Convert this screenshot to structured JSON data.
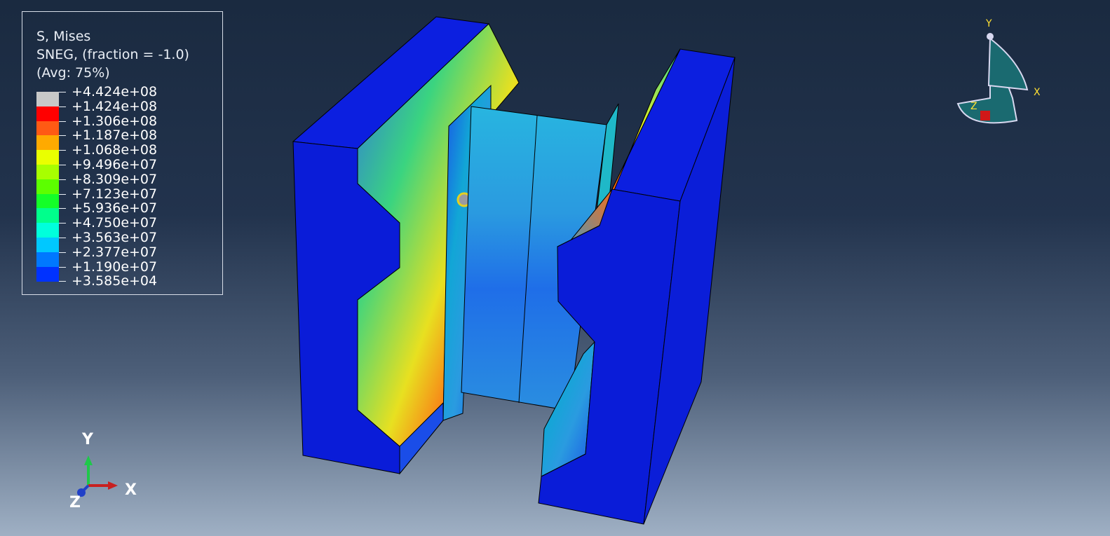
{
  "legend": {
    "line1": "S, Mises",
    "line2": "SNEG, (fraction = -1.0)",
    "line3": "(Avg: 75%)",
    "levels": [
      {
        "label": "+4.424e+08",
        "color": "#c8c8c8"
      },
      {
        "label": "+1.424e+08",
        "color": "#ff0000"
      },
      {
        "label": "+1.306e+08",
        "color": "#ff5a14"
      },
      {
        "label": "+1.187e+08",
        "color": "#ffaa00"
      },
      {
        "label": "+1.068e+08",
        "color": "#eaff00"
      },
      {
        "label": "+9.496e+07",
        "color": "#a8ff00"
      },
      {
        "label": "+8.309e+07",
        "color": "#5cff00"
      },
      {
        "label": "+7.123e+07",
        "color": "#14ff28"
      },
      {
        "label": "+5.936e+07",
        "color": "#00ff8c"
      },
      {
        "label": "+4.750e+07",
        "color": "#00ffdc"
      },
      {
        "label": "+3.563e+07",
        "color": "#00c8ff"
      },
      {
        "label": "+2.377e+07",
        "color": "#0078ff"
      },
      {
        "label": "+1.190e+07",
        "color": "#0032ff"
      },
      {
        "label": "+3.585e+04",
        "color": ""
      }
    ]
  },
  "triad": {
    "x": "X",
    "y": "Y",
    "z": "Z"
  },
  "view_triad": {
    "x": "X",
    "y": "Y",
    "z": "Z"
  },
  "colors": {
    "model_base": "#0a1ee0",
    "outline": "#000000",
    "background_top": "#1a2a40",
    "background_bottom": "#9fb0c4"
  }
}
